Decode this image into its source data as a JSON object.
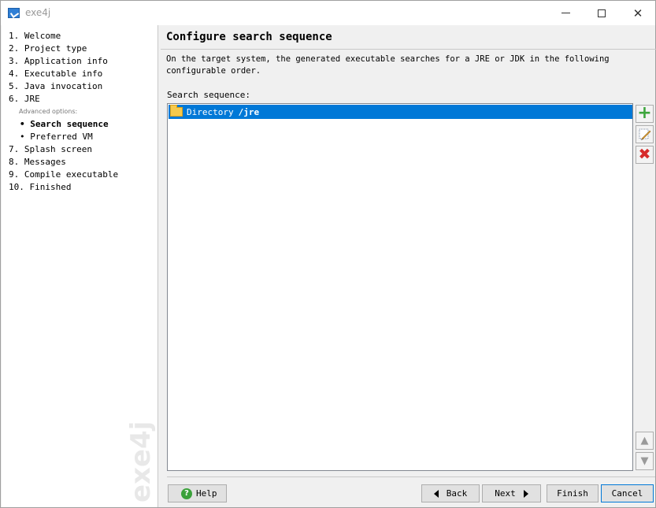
{
  "window": {
    "title": "exe4j",
    "watermark": "exe4j"
  },
  "nav": {
    "items": [
      {
        "label": "1. Welcome"
      },
      {
        "label": "2. Project type"
      },
      {
        "label": "3. Application info"
      },
      {
        "label": "4. Executable info"
      },
      {
        "label": "5. Java invocation"
      },
      {
        "label": "6. JRE"
      },
      {
        "label": "7. Splash screen"
      },
      {
        "label": "8. Messages"
      },
      {
        "label": "9. Compile executable"
      },
      {
        "label": "10. Finished"
      }
    ],
    "advanced_label": "Advanced options:",
    "sub_items": [
      {
        "label": "• Search sequence",
        "selected": true
      },
      {
        "label": "• Preferred VM",
        "selected": false
      }
    ]
  },
  "main": {
    "title": "Configure search sequence",
    "description": "On the target system, the generated executable searches for a JRE or JDK in the following configurable order.",
    "sequence_label": "Search sequence:",
    "sequence": [
      {
        "type": "Directory",
        "path": "/jre"
      }
    ]
  },
  "buttons": {
    "help": "Help",
    "back": "Back",
    "next": "Next",
    "finish": "Finish",
    "cancel": "Cancel"
  },
  "colors": {
    "selection": "#0078d7",
    "add": "#3da63d",
    "remove": "#d62b2b"
  }
}
